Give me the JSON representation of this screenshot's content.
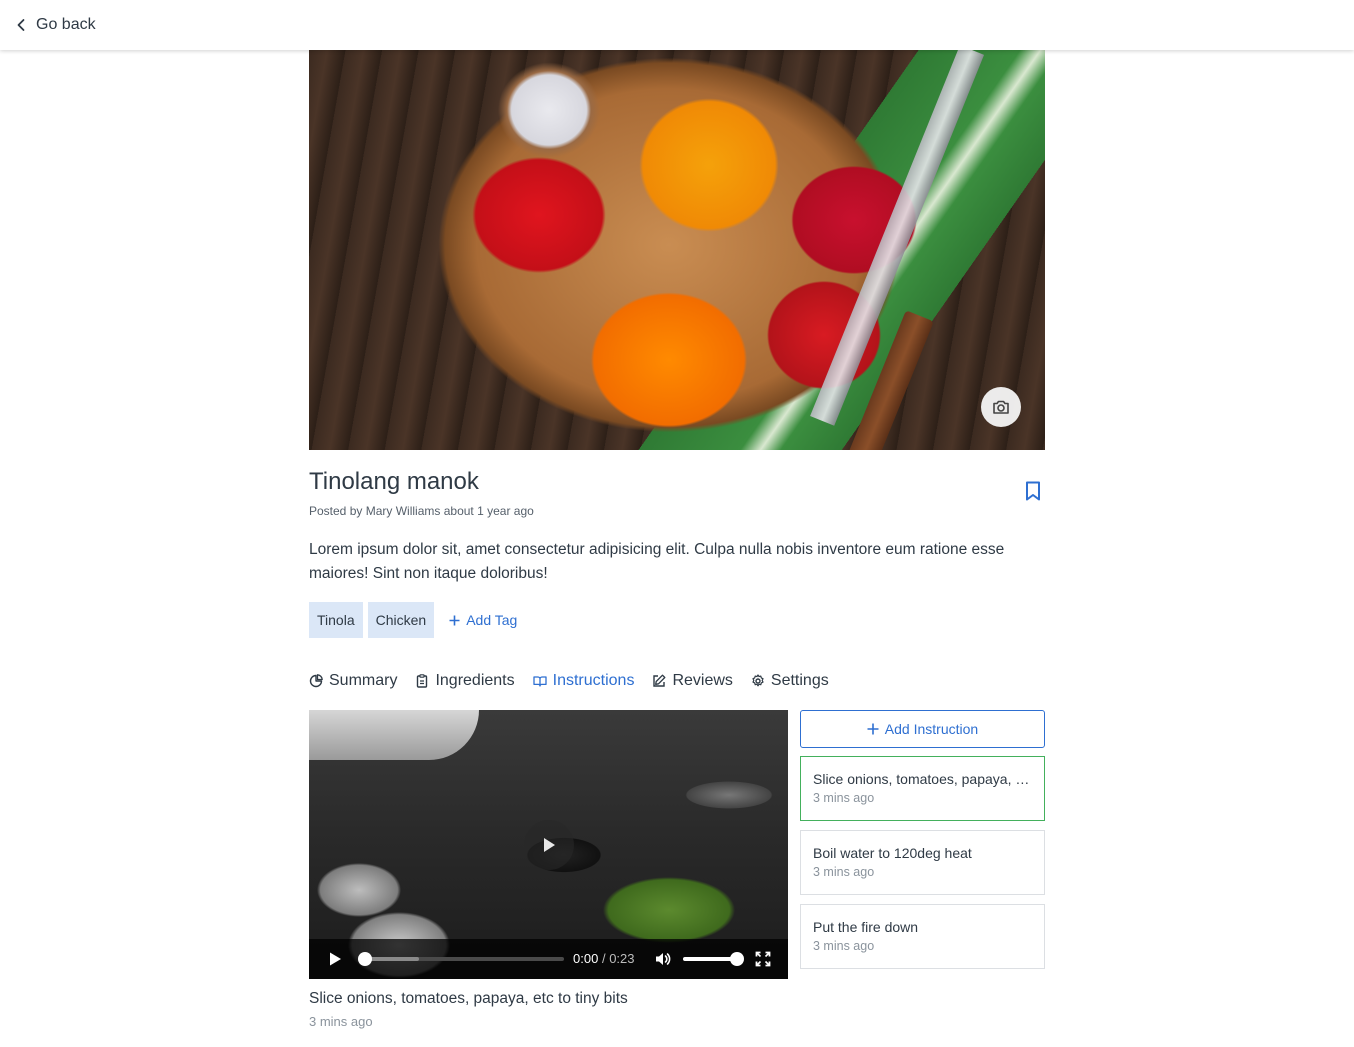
{
  "nav": {
    "back_label": "Go back"
  },
  "recipe": {
    "title": "Tinolang manok",
    "posted_prefix": "Posted by",
    "author": "Mary Williams",
    "posted_when": "about 1 year ago",
    "description": "Lorem ipsum dolor sit, amet consectetur adipisicing elit. Culpa nulla nobis inventore eum ratione esse maiores! Sint non itaque doloribus!"
  },
  "tags": {
    "items": [
      "Tinola",
      "Chicken"
    ],
    "add_label": "Add Tag"
  },
  "tabs": [
    {
      "label": "Summary",
      "icon": "pie-chart-icon",
      "active": false
    },
    {
      "label": "Ingredients",
      "icon": "clipboard-icon",
      "active": false
    },
    {
      "label": "Instructions",
      "icon": "book-open-icon",
      "active": true
    },
    {
      "label": "Reviews",
      "icon": "edit-icon",
      "active": false
    },
    {
      "label": "Settings",
      "icon": "gear-icon",
      "active": false
    }
  ],
  "video": {
    "current_time": "0:00",
    "separator": "/",
    "duration": "0:23",
    "progress": 0,
    "volume": 1.0
  },
  "current_instruction": {
    "text": "Slice onions, tomatoes, papaya, etc to tiny bits",
    "time": "3 mins ago"
  },
  "instructions": {
    "add_label": "Add Instruction",
    "items": [
      {
        "text": "Slice onions, tomatoes, papaya, etc to tiny bits",
        "time": "3 mins ago",
        "active": true
      },
      {
        "text": "Boil water to 120deg heat",
        "time": "3 mins ago",
        "active": false
      },
      {
        "text": "Put the fire down",
        "time": "3 mins ago",
        "active": false
      }
    ]
  },
  "colors": {
    "accent": "#2e6fd1",
    "active_border": "#43b05c",
    "tag_bg": "#dbe7f7",
    "text": "#2f3a45",
    "muted": "#8a939c"
  }
}
